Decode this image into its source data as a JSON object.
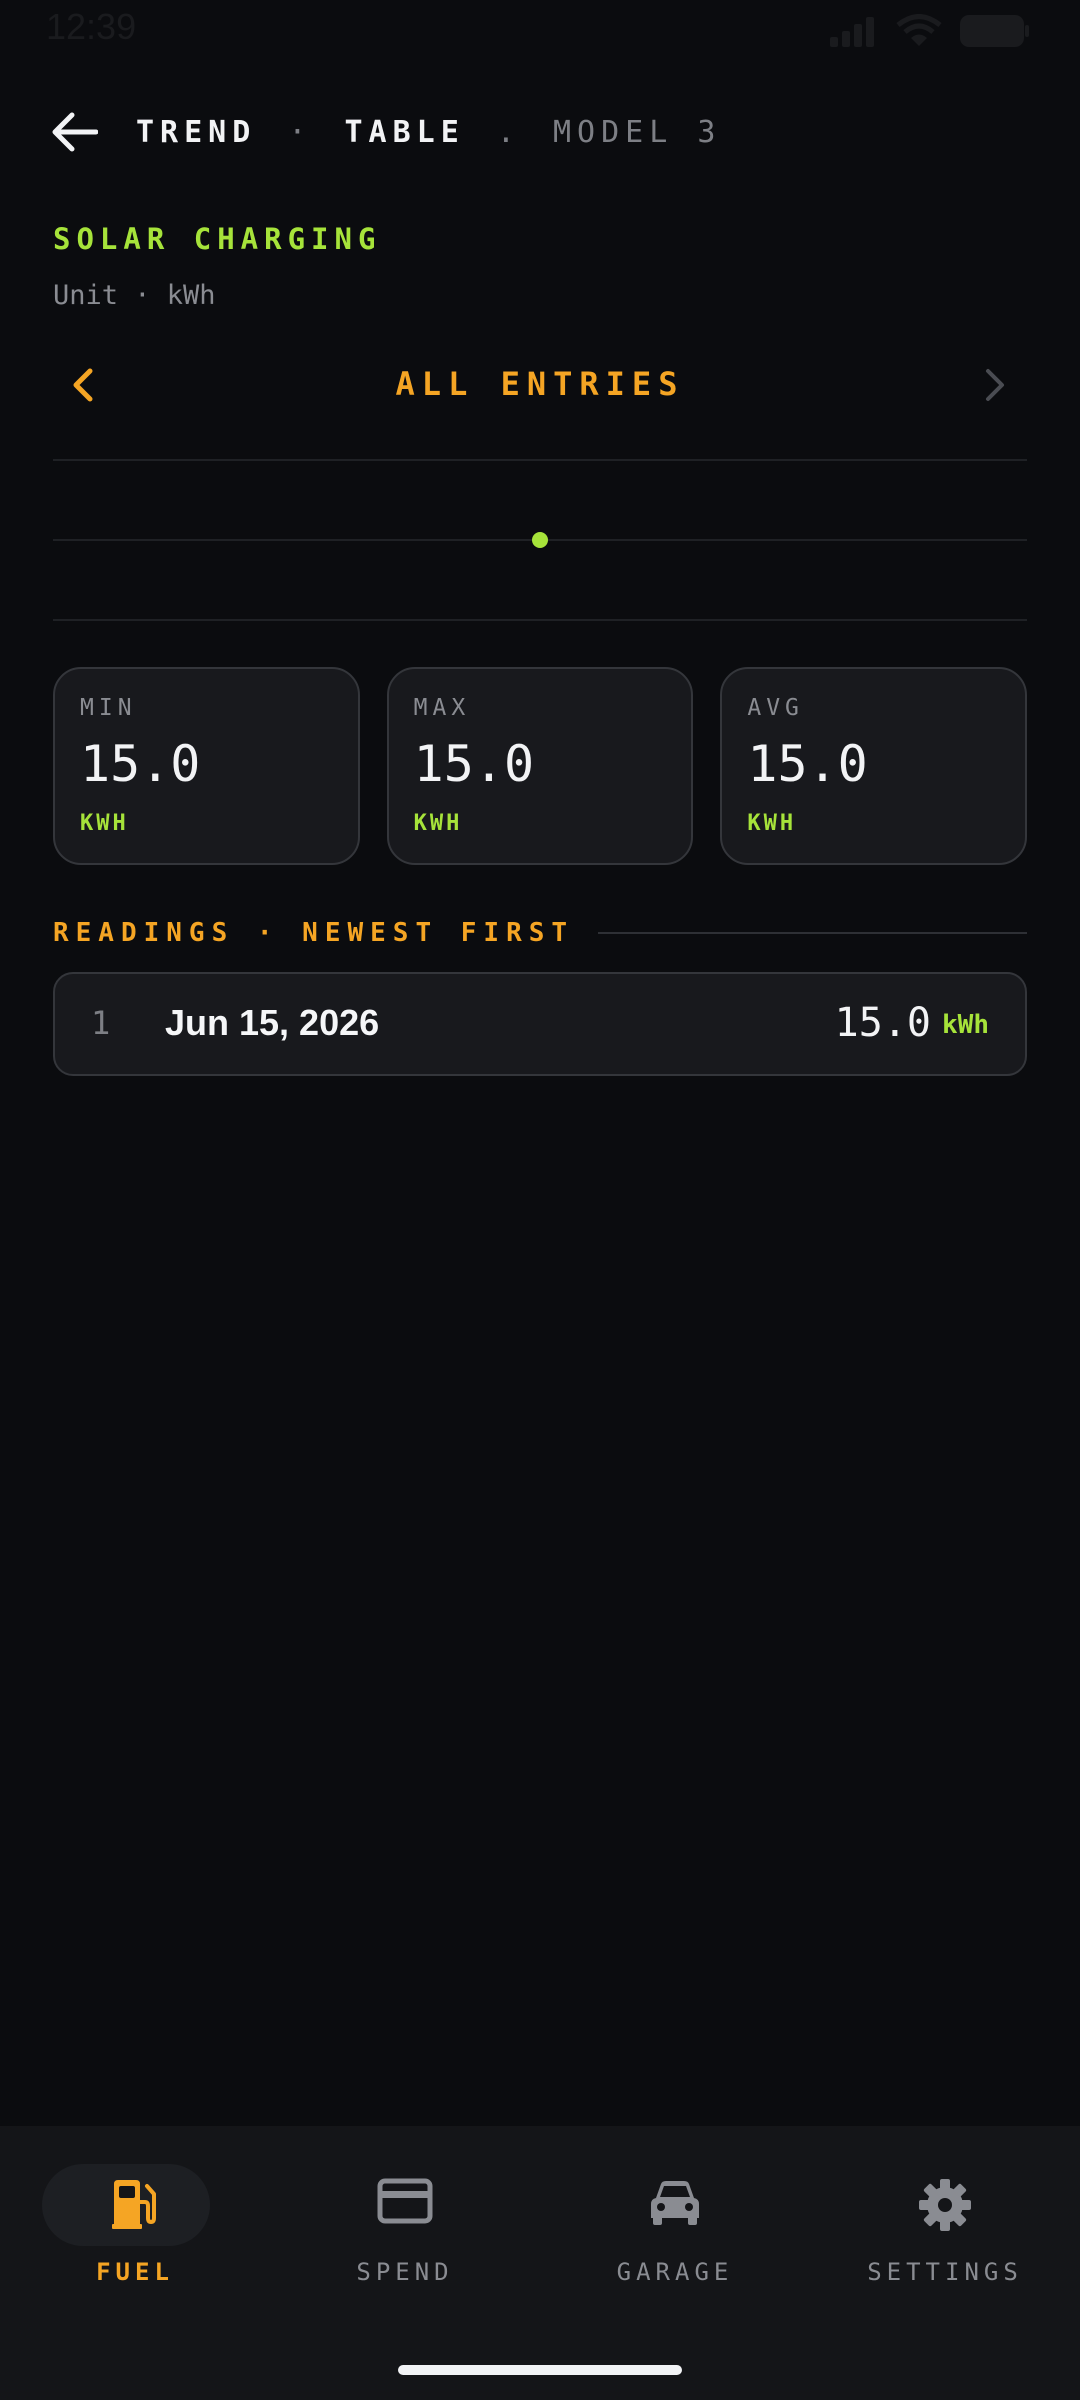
{
  "status_bar": {
    "time": "12:39"
  },
  "header": {
    "crumb_part1": "TREND",
    "crumb_dot": "·",
    "crumb_part2": "TABLE",
    "crumb_sep": ".",
    "crumb_vehicle": "MODEL 3",
    "back_icon": "arrow-left-icon"
  },
  "metric": {
    "title": "SOLAR CHARGING",
    "unit_line": "Unit · kWh"
  },
  "period": {
    "label": "ALL ENTRIES"
  },
  "chart_data": {
    "type": "scatter",
    "x": [
      "Jun 15, 2026"
    ],
    "y": [
      15.0
    ],
    "unit": "kWh",
    "grid": true,
    "color": "#a6e33a"
  },
  "stats": [
    {
      "label": "MIN",
      "value": "15.0",
      "unit": "KWH"
    },
    {
      "label": "MAX",
      "value": "15.0",
      "unit": "KWH"
    },
    {
      "label": "AVG",
      "value": "15.0",
      "unit": "KWH"
    }
  ],
  "readings": {
    "header": "READINGS · NEWEST FIRST",
    "rows": [
      {
        "index": "1",
        "date": "Jun 15, 2026",
        "value": "15.0",
        "unit": "kWh"
      }
    ]
  },
  "bottom_nav": [
    {
      "label": "FUEL",
      "icon": "fuel-pump-icon",
      "active": true
    },
    {
      "label": "SPEND",
      "icon": "credit-card-icon",
      "active": false
    },
    {
      "label": "GARAGE",
      "icon": "car-icon",
      "active": false
    },
    {
      "label": "SETTINGS",
      "icon": "gear-icon",
      "active": false
    }
  ],
  "colors": {
    "accent_orange": "#f5a524",
    "accent_green": "#a6e33a",
    "background": "#0b0c0f",
    "card": "#18191d"
  }
}
